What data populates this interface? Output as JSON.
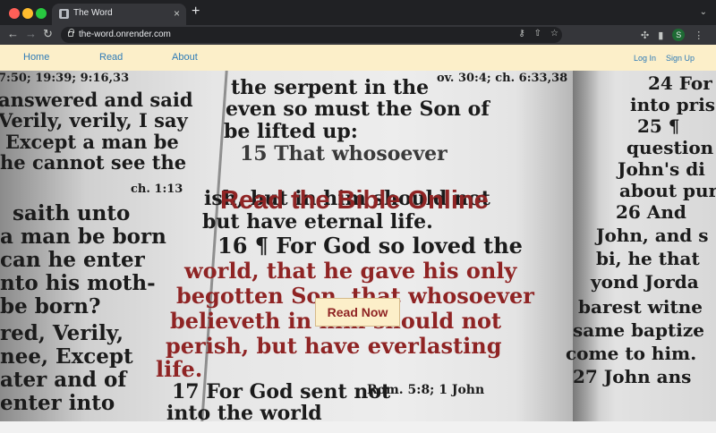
{
  "browser": {
    "tab_title": "The Word",
    "url": "the-word.onrender.com",
    "profile_initial": "S"
  },
  "nav": {
    "home": "Home",
    "read": "Read",
    "about": "About",
    "login": "Log In",
    "signup": "Sign Up"
  },
  "hero": {
    "title": "Read the Bible Online",
    "button": "Read Now"
  },
  "background_text": {
    "left": [
      "7:50; 19:39; 9:16,33",
      "answered and said",
      "Verily, verily, I say",
      "Except a man be",
      "he cannot see the",
      "ch. 1:13",
      "saith unto",
      "a man be born",
      "can he enter",
      "nto his moth-",
      "be born?",
      "red, Verily,",
      "nee, Except",
      "ater and of",
      "enter into"
    ],
    "middle": [
      "ov. 30:4; ch. 6:33,38",
      "the serpent in the",
      "even so must the Son of",
      "be lifted up:",
      "15 That whosoever",
      "ish, but in him should not",
      "but have eternal life.",
      "16 ¶ For God so loved the",
      "world, that he gave his only",
      "begotten Son, that whosoever",
      "believeth in him should not",
      "perish, but have everlasting",
      "life.",
      "17 For God sent not",
      "into the world",
      "Rom. 5:8; 1 John"
    ],
    "right": [
      "24 For",
      "into pris",
      "25 ¶",
      "question",
      "John's di",
      "about puri",
      "26 And",
      "John, and s",
      "bi, he that",
      "yond Jorda",
      "barest witne",
      "same baptize",
      "come to him.",
      "27 John ans"
    ]
  },
  "colors": {
    "navbar_bg": "#fcefc9",
    "link": "#2e7bb7",
    "accent_red": "#8f2424"
  }
}
